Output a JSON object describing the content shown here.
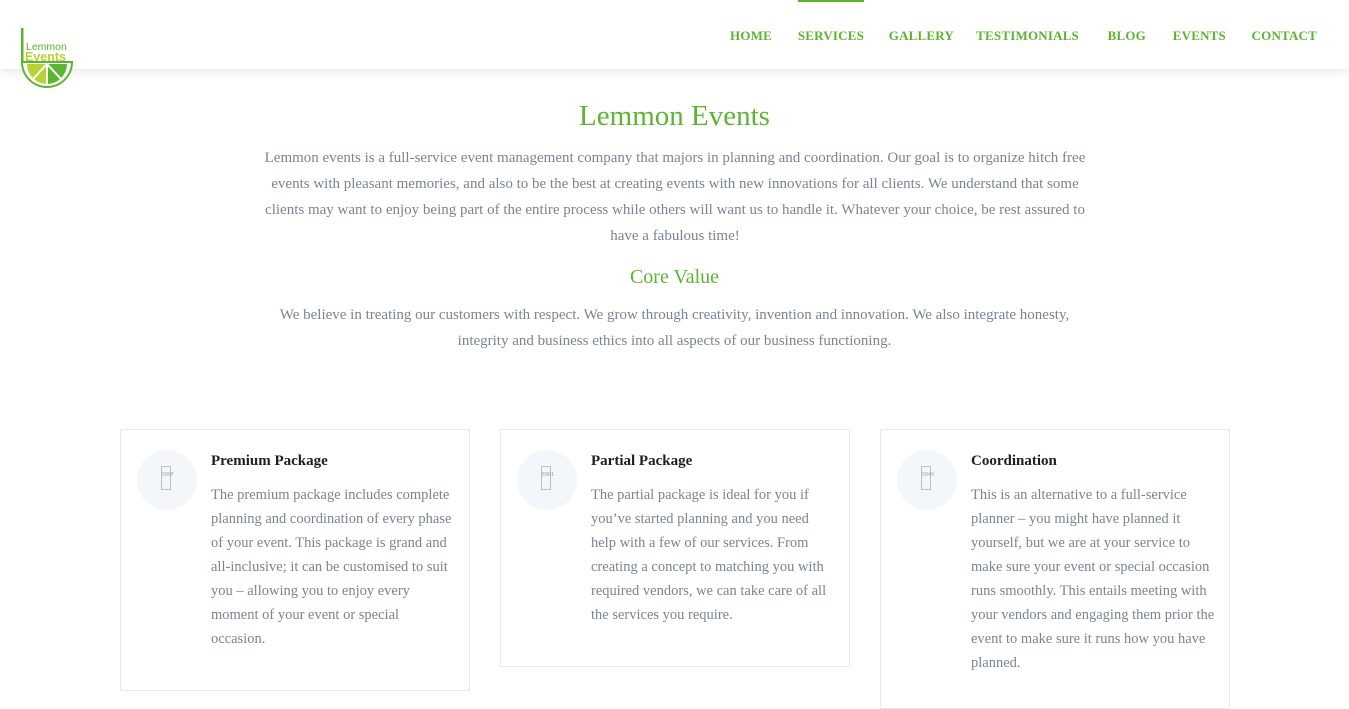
{
  "brand": {
    "logo_line1": "Lemmon",
    "logo_line2": "Events",
    "primary_color": "#5cb531",
    "logo_accent_color": "#b8d432",
    "text_color": "#7a8591"
  },
  "nav": {
    "items": [
      {
        "label": "HOME",
        "active": false
      },
      {
        "label": "SERVICES",
        "active": true
      },
      {
        "label": "GALLERY",
        "active": false
      },
      {
        "label": "TESTIMONIALS",
        "active": false
      },
      {
        "label": "BLOG",
        "active": false
      },
      {
        "label": "EVENTS",
        "active": false
      },
      {
        "label": "CONTACT",
        "active": false
      }
    ]
  },
  "intro": {
    "title": "Lemmon Events",
    "text": "Lemmon events is a full-service event management company that majors in planning and coordination. Our goal is to organize hitch free events with pleasant memories, and also to be the best at creating events with new innovations for all clients. We understand that some clients may want to enjoy being part of the entire process while others will want us to handle it. Whatever your choice, be rest assured to have a fabulous time!"
  },
  "core_value": {
    "title": "Core Value",
    "text": "We believe in treating our customers with respect. We grow through creativity, invention and innovation. We also integrate honesty, integrity and business ethics into all aspects of our business functioning."
  },
  "packages": [
    {
      "icon": "missing-glyph-icon",
      "icon_code": "E00F",
      "title": "Premium Package",
      "text": "The premium package includes complete planning and coordination of every phase of your event. This package is grand and all-inclusive; it can be customised to suit you – allowing you to enjoy every moment of your event or special occasion."
    },
    {
      "icon": "missing-glyph-icon",
      "icon_code": "E001",
      "title": "Partial Package",
      "text": "The partial package is ideal for you if you’ve started planning and you need help with a few of our services. From creating a concept to matching you with required vendors, we can take care of all the services you require."
    },
    {
      "icon": "missing-glyph-icon",
      "icon_code": "E049",
      "title": "Coordination",
      "text": "This is an alternative to a full-service planner – you might have planned it yourself, but we are at your service to make sure your event or special occasion runs smoothly. This entails meeting with your vendors and engaging them prior the event to make sure it runs how you have planned."
    }
  ]
}
